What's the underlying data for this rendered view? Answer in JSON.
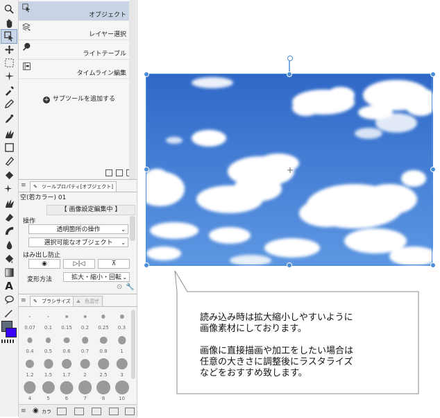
{
  "subtool": {
    "items": [
      {
        "label": "オブジェクト",
        "icon": "object-select-icon",
        "active": true
      },
      {
        "label": "レイヤー選択",
        "icon": "layer-select-icon",
        "active": false
      },
      {
        "label": "ライトテーブル",
        "icon": "light-table-icon",
        "active": false
      },
      {
        "label": "タイムライン編集",
        "icon": "timeline-icon",
        "active": false
      }
    ],
    "add_label": "サブツールを追加する"
  },
  "toolprop": {
    "tab1": "ツールプロパティ[オブジェクト]",
    "name": "空(若カラー) 01",
    "banner": "【 画像設定編集中 】",
    "op_label": "操作",
    "op_select1": "透明箇所の操作",
    "op_select2": "選択可能なオブジェクト",
    "overflow_label": "はみ出し防止",
    "transform_label": "変形方法",
    "transform_value": "拡大・縮小・回転"
  },
  "brush": {
    "tab1": "ブラシサイズ",
    "tab2": "色混ぜ",
    "sizes": [
      "0.07",
      "0.1",
      "0.15",
      "0.2",
      "0.25",
      "0.3",
      "0.4",
      "0.5",
      "0.6",
      "0.7",
      "0.8",
      "1",
      "1.2",
      "1.5",
      "1.7",
      "2",
      "2.5",
      "3",
      "4",
      "5",
      "6",
      "7",
      "8",
      "10"
    ],
    "bottom_tab": "カラ"
  },
  "callout": {
    "text": "読み込み時は拡大縮小しやすいように\n画像素材にしております。\n\n画像に直接描画や加工をしたい場合は\n任意の大きさに調整後にラスタライズ\nなどをおすすめ致します。"
  },
  "colors": {
    "main": "#5e6b7a",
    "sub": "#3a00ff",
    "selection": "#4a8fd8"
  }
}
